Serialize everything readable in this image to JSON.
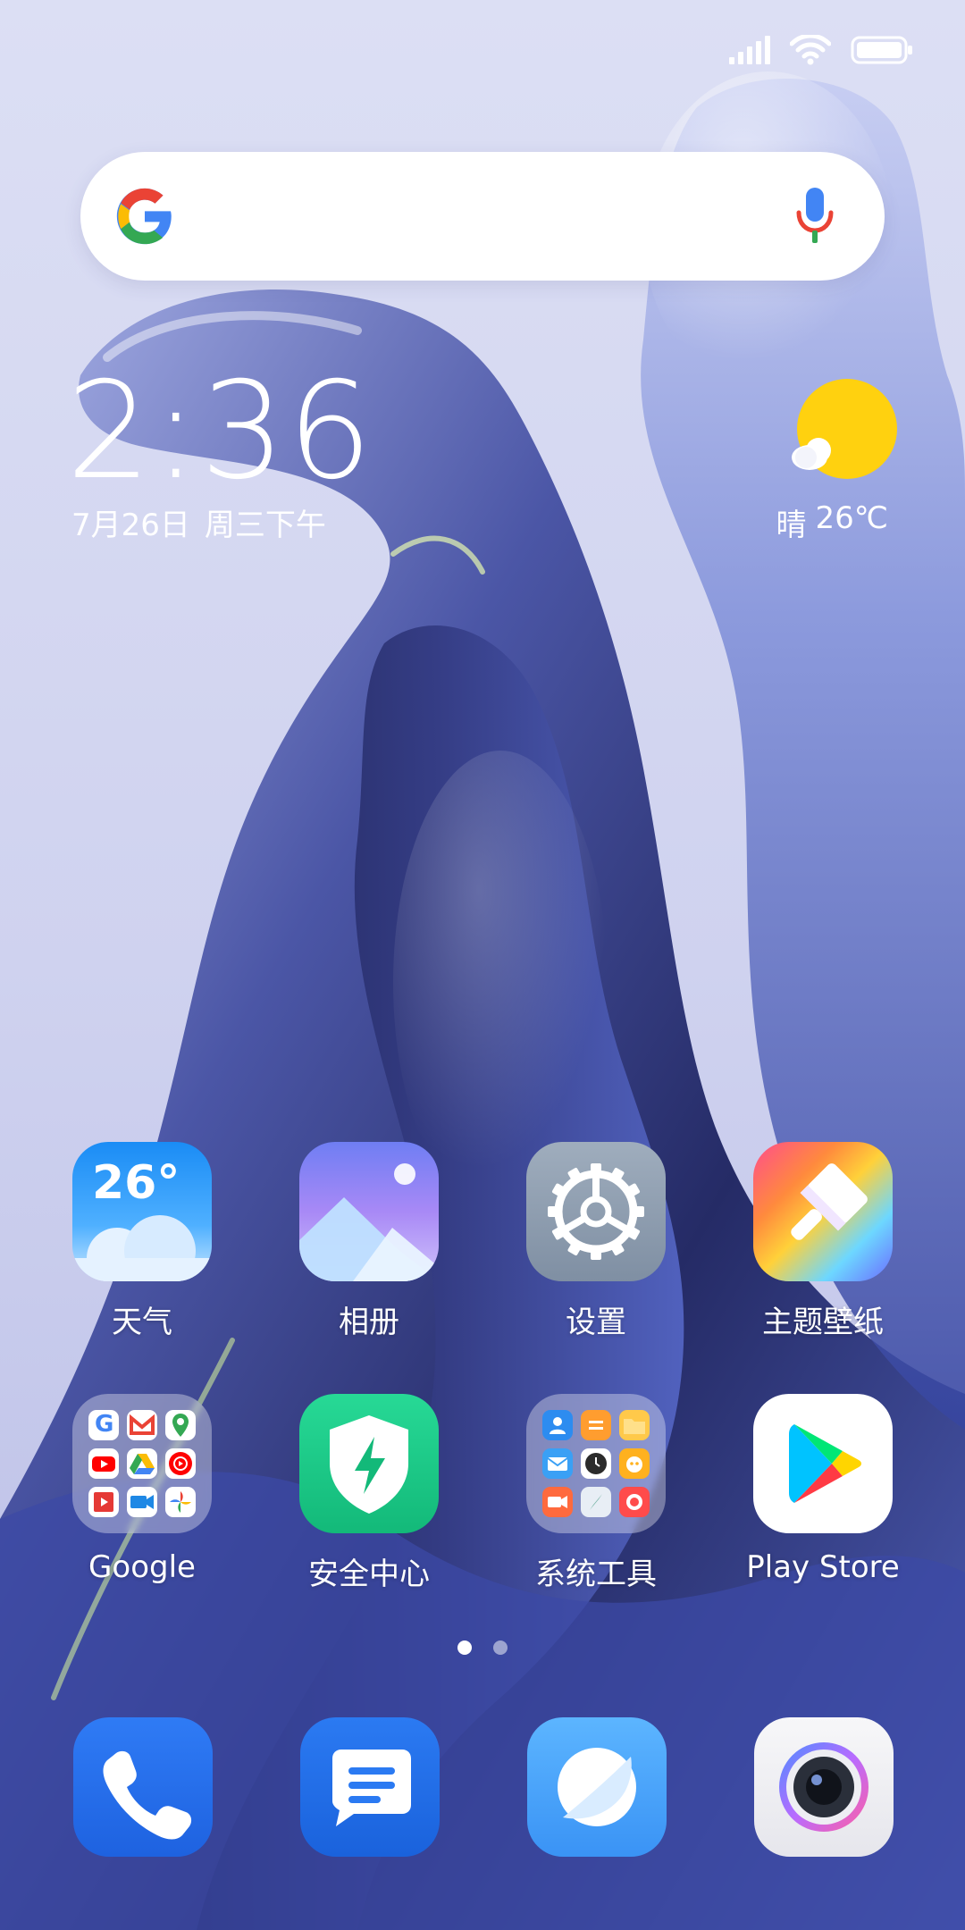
{
  "status_bar": {
    "signal_icon": "cell-signal-icon",
    "wifi_icon": "wifi-icon",
    "battery_icon": "battery-icon"
  },
  "search": {
    "placeholder": "",
    "logo_icon": "google-g-icon",
    "mic_icon": "microphone-icon"
  },
  "clock_widget": {
    "time": "2:36",
    "date": "7月26日",
    "weekday": "周三",
    "period": "下午"
  },
  "weather_widget": {
    "icon": "sunny-cloud-icon",
    "condition": "晴",
    "temperature": "26℃"
  },
  "apps": [
    {
      "label": "天气",
      "icon": "weather-icon",
      "badge_text": "26°"
    },
    {
      "label": "相册",
      "icon": "gallery-icon"
    },
    {
      "label": "设置",
      "icon": "settings-gear-icon"
    },
    {
      "label": "主题壁纸",
      "icon": "themes-brush-icon"
    },
    {
      "label": "Google",
      "icon": "google-folder-icon"
    },
    {
      "label": "安全中心",
      "icon": "security-shield-icon"
    },
    {
      "label": "系统工具",
      "icon": "tools-folder-icon"
    },
    {
      "label": "Play Store",
      "icon": "play-store-icon"
    }
  ],
  "pages": {
    "count": 2,
    "current": 1
  },
  "dock": [
    {
      "name": "phone",
      "icon": "phone-icon"
    },
    {
      "name": "messages",
      "icon": "messages-icon"
    },
    {
      "name": "browser",
      "icon": "browser-icon"
    },
    {
      "name": "camera",
      "icon": "camera-icon"
    }
  ],
  "colors": {
    "background": "#d9dcf2",
    "wallpaper_dark": "#2c3470",
    "accent_blue": "#2d6fe8",
    "weather_sun": "#ffd10f"
  }
}
